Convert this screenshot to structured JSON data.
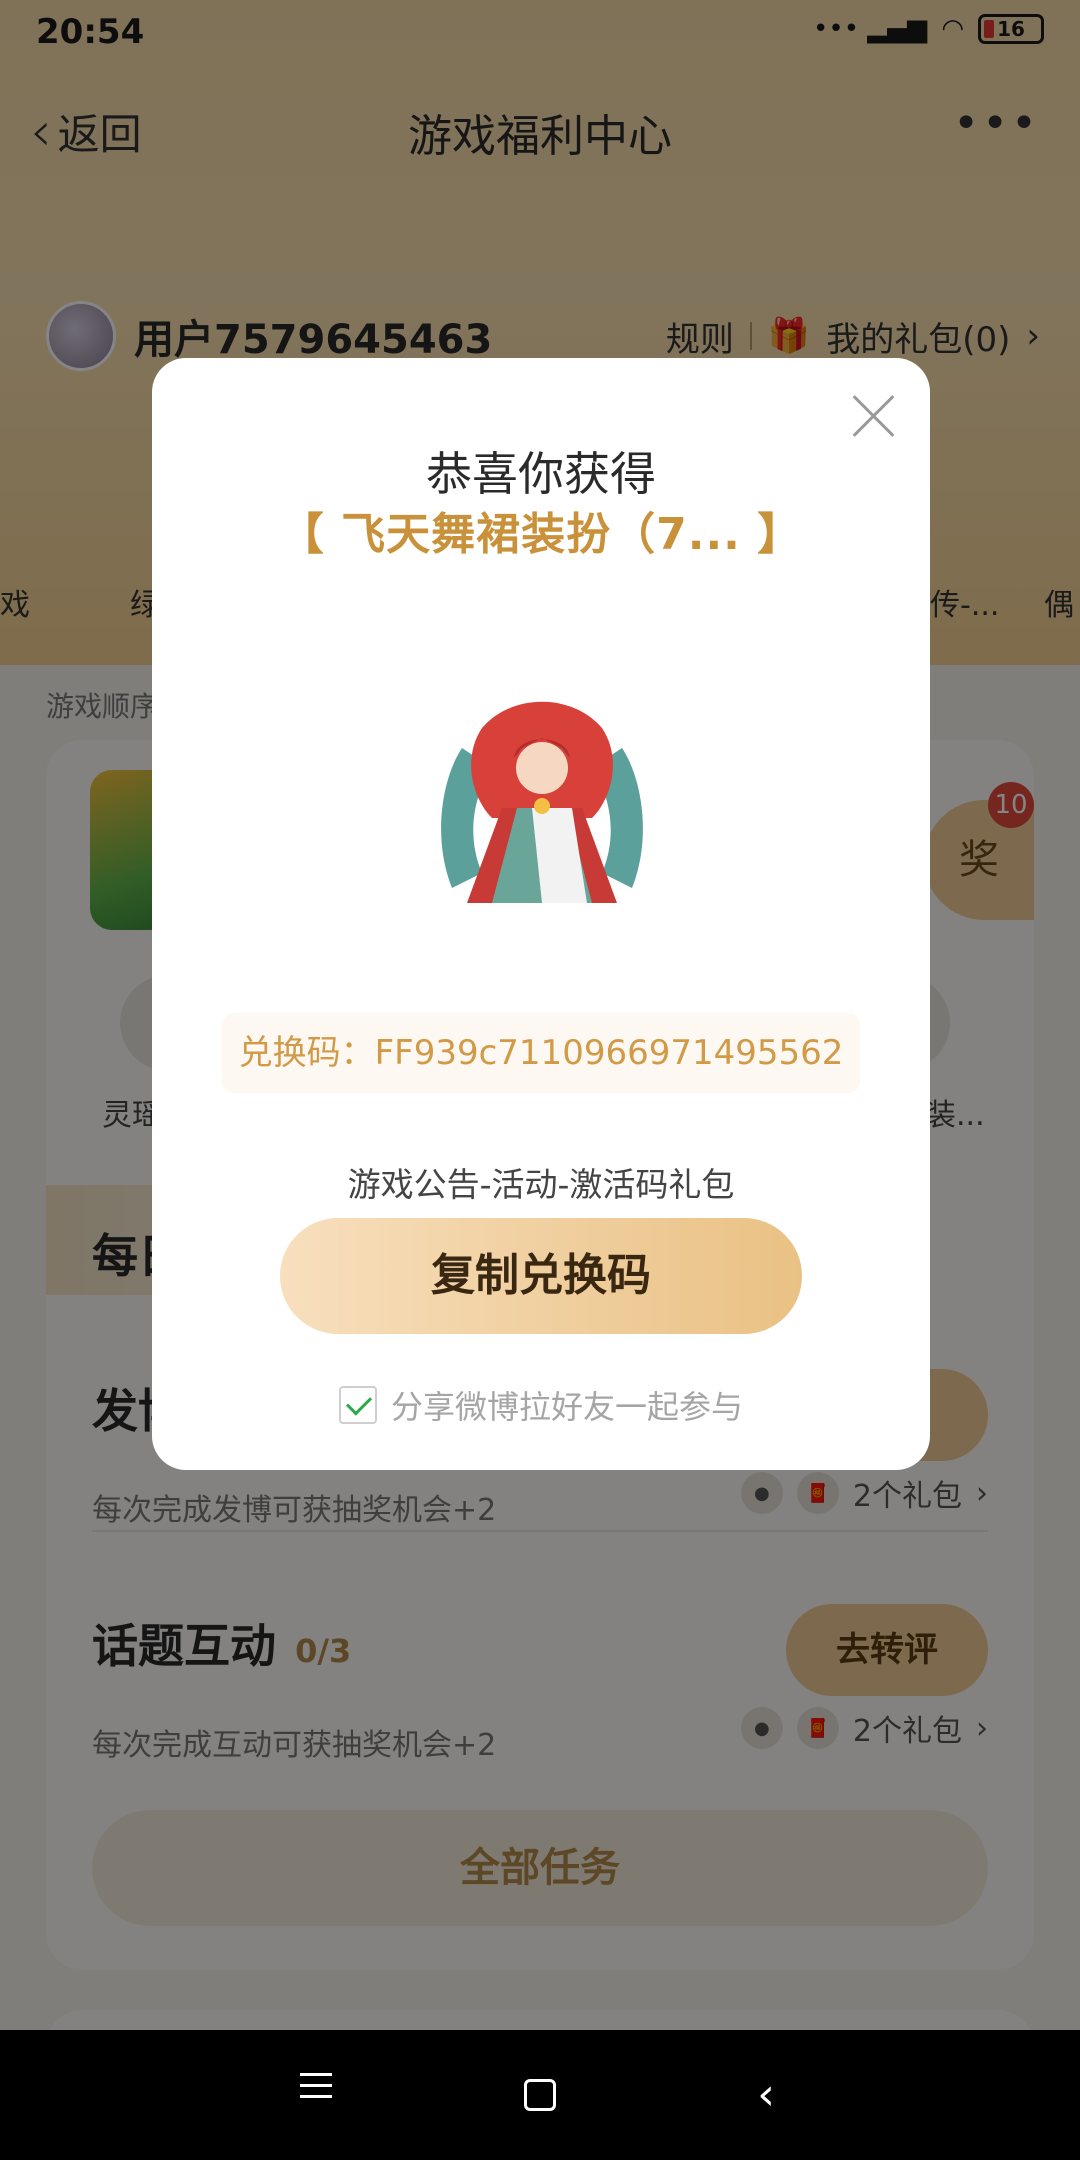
{
  "status_bar": {
    "time": "20:54",
    "signal": "••• 📶",
    "battery": "16"
  },
  "nav": {
    "back_label": "返回",
    "title": "游戏福利中心",
    "more": "•••"
  },
  "user": {
    "name": "用户7579645463",
    "rules": "规则",
    "my_gifts": "我的礼包(0)"
  },
  "game_strip": [
    "戏",
    "绿",
    "传-...",
    "偶"
  ],
  "order_label": "游戏顺序",
  "card": {
    "lottery_label": "奖",
    "badge_count": "10",
    "rewards": [
      "灵瑶",
      "装..."
    ],
    "daily_title": "每日",
    "tasks": [
      {
        "title": "发博",
        "progress": "",
        "desc": "每次完成发博可获抽奖机会+2",
        "button": "博",
        "gifts": "2个礼包"
      },
      {
        "title": "话题互动",
        "progress": "0/3",
        "desc": "每次完成互动可获抽奖机会+2",
        "button": "去转评",
        "gifts": "2个礼包"
      }
    ],
    "all_tasks": "全部任务"
  },
  "modal": {
    "title": "恭喜你获得",
    "prize": "【  飞天舞裙装扮（7...  】",
    "code": "兑换码：FF939c7110966971495562",
    "source": "游戏公告-活动-激活码礼包",
    "copy_button": "复制兑换码",
    "share_label": "分享微博拉好友一起参与",
    "share_checked": true
  },
  "colors": {
    "accent": "#c9923a",
    "button_gold": "#e9c184",
    "check": "#2ea84a"
  }
}
